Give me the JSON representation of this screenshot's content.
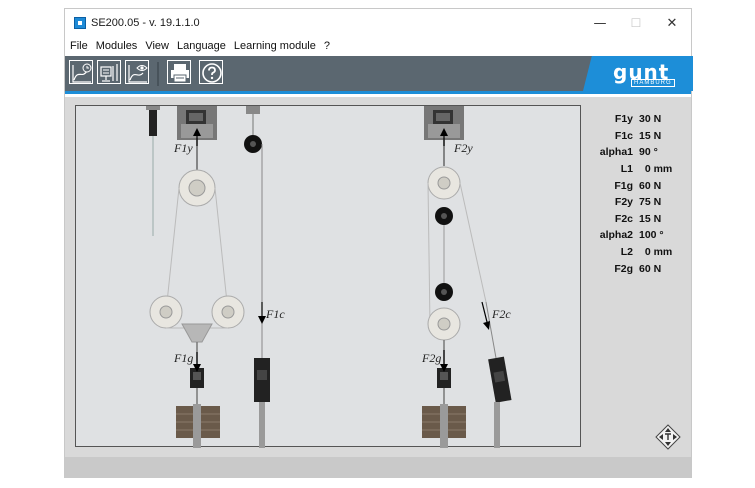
{
  "window": {
    "title": "SE200.05 - v. 19.1.1.0",
    "minimize_glyph": "—",
    "maximize_glyph": "☐",
    "close_glyph": "✕"
  },
  "menu": {
    "items": [
      {
        "label": "File"
      },
      {
        "label": "Modules"
      },
      {
        "label": "View"
      },
      {
        "label": "Language"
      },
      {
        "label": "Learning module"
      },
      {
        "label": "?"
      }
    ]
  },
  "toolbar": {
    "buttons": [
      {
        "icon": "chart-clock-icon"
      },
      {
        "icon": "chart-monitor-icon"
      },
      {
        "icon": "chart-eye-icon"
      },
      {
        "icon": "printer-icon"
      },
      {
        "icon": "help-icon"
      }
    ],
    "logo": {
      "word": "gunt",
      "sub": "HAMBURG"
    }
  },
  "colors": {
    "toolbar": "#5b6770",
    "accent": "#1d8ed8",
    "workspace": "#d9d9d9"
  },
  "diagram": {
    "labels": {
      "f1y": "F1y",
      "f1c": "F1c",
      "f1g": "F1g",
      "f2y": "F2y",
      "f2c": "F2c",
      "f2g": "F2g"
    }
  },
  "readouts": [
    {
      "label": "F1y",
      "value": "30 N"
    },
    {
      "label": "F1c",
      "value": "15 N"
    },
    {
      "label": "alpha1",
      "value": "90 °"
    },
    {
      "label": "L1",
      "value": "  0 mm"
    },
    {
      "label": "F1g",
      "value": "60 N"
    },
    {
      "label": "F2y",
      "value": "75 N"
    },
    {
      "label": "F2c",
      "value": "15 N"
    },
    {
      "label": "alpha2",
      "value": "100 °"
    },
    {
      "label": "L2",
      "value": "  0 mm"
    },
    {
      "label": "F2g",
      "value": "60 N"
    }
  ]
}
